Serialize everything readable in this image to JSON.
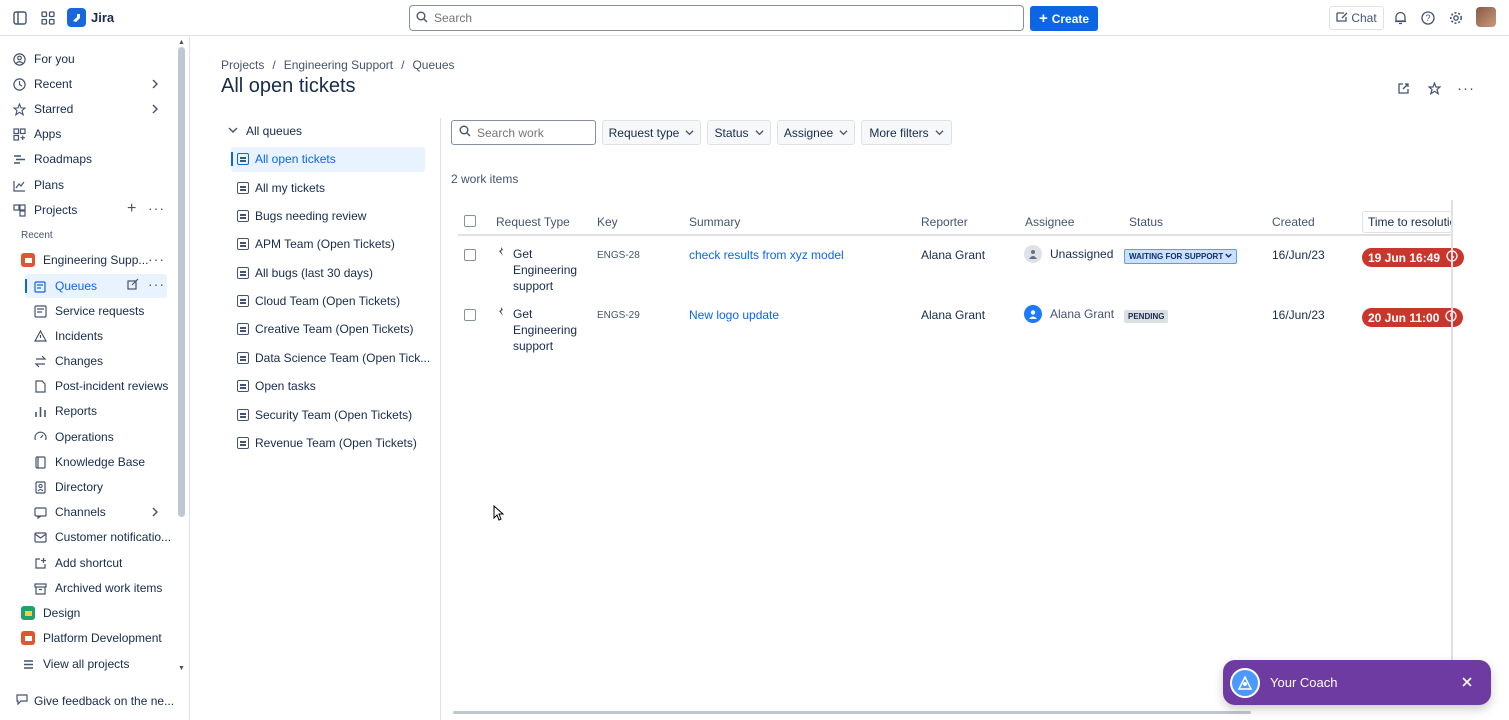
{
  "topbar": {
    "app_name": "Jira",
    "search_placeholder": "Search",
    "create_label": "Create",
    "chat_label": "Chat"
  },
  "sidebar": {
    "items": [
      {
        "label": "For you",
        "icon": "user-circle-icon"
      },
      {
        "label": "Recent",
        "icon": "clock-icon"
      },
      {
        "label": "Starred",
        "icon": "star-icon"
      },
      {
        "label": "Apps",
        "icon": "apps-icon"
      },
      {
        "label": "Roadmaps",
        "icon": "roadmap-icon"
      },
      {
        "label": "Plans",
        "icon": "plans-icon"
      },
      {
        "label": "Projects",
        "icon": "projects-icon"
      }
    ],
    "recent_header": "Recent",
    "project": "Engineering Supp...",
    "project_sub": [
      {
        "label": "Queues",
        "icon": "queues-icon"
      },
      {
        "label": "Service requests",
        "icon": "service-requests-icon"
      },
      {
        "label": "Incidents",
        "icon": "incidents-icon"
      },
      {
        "label": "Changes",
        "icon": "changes-icon"
      },
      {
        "label": "Post-incident reviews",
        "icon": "reviews-icon"
      },
      {
        "label": "Reports",
        "icon": "reports-icon"
      },
      {
        "label": "Operations",
        "icon": "operations-icon"
      },
      {
        "label": "Knowledge Base",
        "icon": "knowledge-base-icon"
      },
      {
        "label": "Directory",
        "icon": "directory-icon"
      },
      {
        "label": "Channels",
        "icon": "channels-icon"
      },
      {
        "label": "Customer notificatio...",
        "icon": "notifications-icon"
      },
      {
        "label": "Add shortcut",
        "icon": "add-shortcut-icon"
      },
      {
        "label": "Archived work items",
        "icon": "archive-icon"
      }
    ],
    "other_projects": [
      "Design",
      "Platform Development"
    ],
    "view_all": "View all projects",
    "feedback": "Give feedback on the ne..."
  },
  "breadcrumb": {
    "items": [
      "Projects",
      "Engineering Support",
      "Queues"
    ],
    "separator": "/"
  },
  "page_title": "All open tickets",
  "queues": {
    "header": "All queues",
    "items": [
      "All open tickets",
      "All my tickets",
      "Bugs needing review",
      "APM Team (Open Tickets)",
      "All bugs (last 30 days)",
      "Cloud Team (Open Tickets)",
      "Creative Team (Open Tickets)",
      "Data Science Team (Open Tick...",
      "Open tasks",
      "Security Team (Open Tickets)",
      "Revenue Team (Open Tickets)"
    ]
  },
  "filters": {
    "search_placeholder": "Search work",
    "request_type": "Request type",
    "status": "Status",
    "assignee": "Assignee",
    "more_filters": "More filters"
  },
  "count_label": "2 work items",
  "table": {
    "headers": [
      "Request Type",
      "Key",
      "Summary",
      "Reporter",
      "Assignee",
      "Status",
      "Created",
      "Time to resolutio"
    ],
    "rows": [
      {
        "request_type": "Get Engineering support",
        "key": "ENGS-28",
        "summary": "check results from xyz model",
        "reporter": "Alana Grant",
        "assignee": "Unassigned",
        "status": "WAITING FOR SUPPORT",
        "created": "16/Jun/23",
        "ttr": "19 Jun 16:49"
      },
      {
        "request_type": "Get Engineering support",
        "key": "ENGS-29",
        "summary": "New logo update",
        "reporter": "Alana Grant",
        "assignee": "Alana Grant",
        "status": "PENDING",
        "created": "16/Jun/23",
        "ttr": "20 Jun 11:00"
      }
    ]
  },
  "coach": {
    "label": "Your Coach"
  },
  "colors": {
    "primary": "#0c66e4",
    "breach": "#c9372c",
    "coach_bg": "#6e3ba3"
  }
}
